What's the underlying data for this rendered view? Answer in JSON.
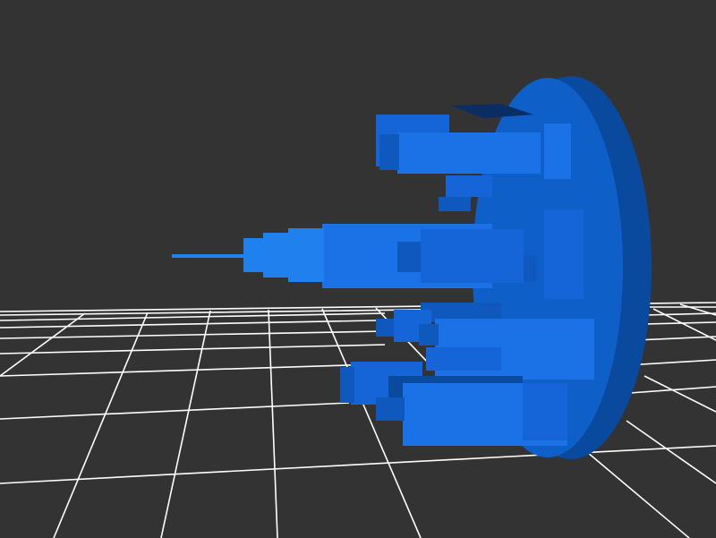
{
  "scene": {
    "background_color": "#333333",
    "grid_color": "#ffffff",
    "model_color": "#1565d8",
    "model_highlight": "#1f80ee",
    "model_shadow": "#0b3f86",
    "model_dark": "#0a2e63"
  }
}
